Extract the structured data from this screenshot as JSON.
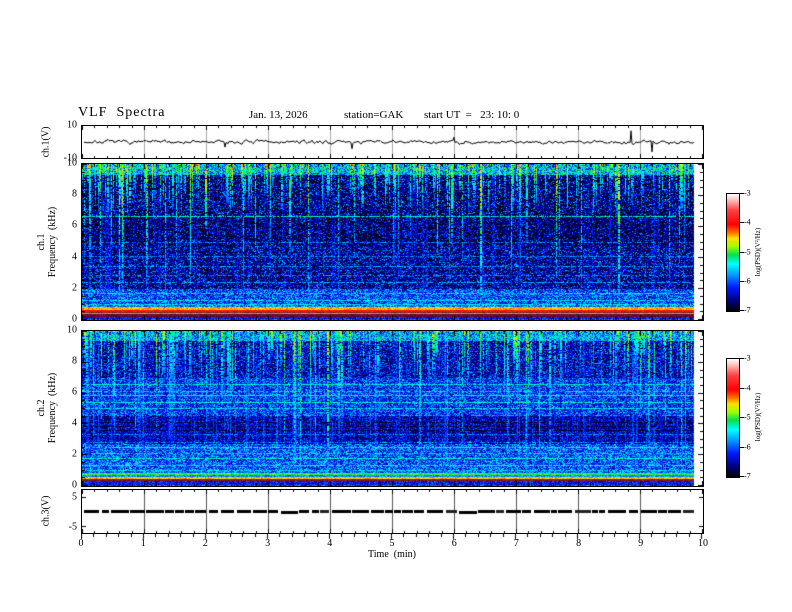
{
  "title": {
    "main": "VLF  Spectra",
    "date": "Jan. 13, 2026",
    "station": "station=GAK",
    "start": "start UT  =   23: 10: 0"
  },
  "axis": {
    "x_label": "Time  (min)",
    "x_ticks": [
      "0",
      "1",
      "2",
      "3",
      "4",
      "5",
      "6",
      "7",
      "8",
      "9",
      "10"
    ],
    "spec_y_ticks": [
      "10",
      "8",
      "6",
      "4",
      "2",
      "0"
    ],
    "wave_y_ticks": [
      "10",
      "-10"
    ],
    "ch3_y_ticks": [
      "5",
      "-5"
    ]
  },
  "labels": {
    "ch1_wave": "ch.1(V)",
    "spec1_line1": "ch.1",
    "spec1_line2": "Frequency  (kHz)",
    "spec2_line1": "ch.2",
    "spec2_line2": "Frequency  (kHz)",
    "ch3": "ch.3(V)"
  },
  "colorbar": {
    "label": "log(PSD)(V²/Hz)",
    "ticks": [
      "-3",
      "-4",
      "-5",
      "-6",
      "-7"
    ]
  },
  "chart_data": [
    {
      "panel": "ch1_waveform",
      "type": "line",
      "ylabel": "ch.1(V)",
      "ylim": [
        -10,
        10
      ],
      "xlim": [
        0,
        10
      ],
      "data_frac": 0.985,
      "baseline_v": 0,
      "noise_amp_v": 1.6,
      "spikes": [
        {
          "t": 2.3,
          "v": -3.2
        },
        {
          "t": 4.35,
          "v": -4.2
        },
        {
          "t": 6.0,
          "v": 3.0
        },
        {
          "t": 8.85,
          "v": 7.0
        },
        {
          "t": 9.2,
          "v": -6.2
        }
      ],
      "seed": 7
    },
    {
      "panel": "ch1_spectrogram",
      "type": "heatmap",
      "ylabel": "ch.1 Frequency (kHz)",
      "ylim": [
        0,
        10
      ],
      "xlim": [
        0,
        10
      ],
      "data_frac": 0.985,
      "colorbar": {
        "label": "log(PSD)(V²/Hz)",
        "ticks": [
          -3,
          -4,
          -5,
          -6,
          -7
        ],
        "zlim": [
          -7,
          -3
        ]
      },
      "seed": 11,
      "regions": [
        {
          "f": [
            9.35,
            10.01
          ],
          "base": 0.15,
          "amp": 0.38,
          "pow": 1
        },
        {
          "f": [
            6.6,
            9.35
          ],
          "base": 0.02,
          "amp": 0.34,
          "pow": 3
        },
        {
          "f": [
            4.8,
            6.6
          ],
          "base": 0.02,
          "amp": 0.3,
          "pow": 3
        },
        {
          "f": [
            2.0,
            4.8
          ],
          "base": 0.03,
          "amp": 0.32,
          "pow": 2.4
        },
        {
          "f": [
            1.0,
            2.0
          ],
          "base": 0.1,
          "amp": 0.3,
          "pow": 1.2
        },
        {
          "f": [
            0.85,
            1.0
          ],
          "base": 0.16,
          "amp": 0.26,
          "pow": 1
        },
        {
          "f": [
            0.0,
            0.85
          ],
          "base": 0.12,
          "amp": 0.2,
          "pow": 1
        }
      ],
      "hlines": [
        {
          "f": 6.65,
          "v": 0.42,
          "p": 0.8
        },
        {
          "f": 5.0,
          "v": 0.3,
          "p": 0.5
        },
        {
          "f": 4.1,
          "v": 0.3,
          "p": 0.5
        },
        {
          "f": 3.45,
          "v": 0.32,
          "p": 0.6
        },
        {
          "f": 2.9,
          "v": 0.3,
          "p": 0.5
        },
        {
          "f": 2.45,
          "v": 0.32,
          "p": 0.6
        },
        {
          "f": 1.75,
          "v": 0.36,
          "p": 0.7
        },
        {
          "f": 1.3,
          "v": 0.38,
          "p": 0.7
        },
        {
          "f": 1.05,
          "v": 0.4,
          "p": 0.8
        }
      ],
      "darklines": [],
      "bands": [
        {
          "f": [
            0.62,
            0.85
          ],
          "v": 0.64,
          "j": 0.05
        },
        {
          "f": [
            0.54,
            0.62
          ],
          "v": 0.74,
          "j": 0.03
        },
        {
          "f": [
            0.46,
            0.54
          ],
          "rgb": [
            150,
            20,
            30
          ],
          "j": 35
        },
        {
          "f": [
            0.38,
            0.46
          ],
          "v": 0.5,
          "j": 0.04
        },
        {
          "f": [
            0.22,
            0.38
          ],
          "rgb": [
            115,
            5,
            45
          ],
          "j": 30
        },
        {
          "f": [
            0.04,
            0.22
          ],
          "v": 0.18,
          "j": 0.1
        }
      ],
      "streaks": {
        "count": 250,
        "depth": [
          0.8,
          3.2
        ],
        "deepProb": 0.2,
        "deepDepth": [
          3.5,
          9.8
        ],
        "v": [
          0.42,
          0.68
        ]
      },
      "faint": {
        "count": 140,
        "v": [
          0.1,
          0.22
        ]
      },
      "dots": {
        "count": 10,
        "f": [
          7.0,
          9.6
        ],
        "v": [
          0.75,
          0.95
        ]
      }
    },
    {
      "panel": "ch2_spectrogram",
      "type": "heatmap",
      "ylabel": "ch.2 Frequency (kHz)",
      "ylim": [
        0,
        10
      ],
      "xlim": [
        0,
        10
      ],
      "data_frac": 0.985,
      "colorbar": {
        "label": "log(PSD)(V²/Hz)",
        "ticks": [
          -3,
          -4,
          -5,
          -6,
          -7
        ],
        "zlim": [
          -7,
          -3
        ]
      },
      "seed": 23,
      "regions": [
        {
          "f": [
            9.4,
            10.01
          ],
          "base": 0.15,
          "amp": 0.33,
          "pow": 1
        },
        {
          "f": [
            7.0,
            9.4
          ],
          "base": 0.05,
          "amp": 0.3,
          "pow": 2.2
        },
        {
          "f": [
            4.6,
            7.0
          ],
          "base": 0.1,
          "amp": 0.28,
          "pow": 1.4
        },
        {
          "f": [
            2.9,
            4.6
          ],
          "base": 0.05,
          "amp": 0.24,
          "pow": 2
        },
        {
          "f": [
            1.0,
            2.9
          ],
          "base": 0.11,
          "amp": 0.3,
          "pow": 1.2
        },
        {
          "f": [
            0.85,
            1.0
          ],
          "base": 0.14,
          "amp": 0.26,
          "pow": 1
        },
        {
          "f": [
            0.0,
            0.85
          ],
          "base": 0.12,
          "amp": 0.2,
          "pow": 1
        }
      ],
      "hlines": [
        {
          "f": 6.6,
          "v": 0.42,
          "p": 0.8
        },
        {
          "f": 6.15,
          "v": 0.38,
          "p": 0.6
        },
        {
          "f": 5.9,
          "v": 0.44,
          "p": 0.8
        },
        {
          "f": 5.45,
          "v": 0.42,
          "p": 0.8
        },
        {
          "f": 5.05,
          "v": 0.4,
          "p": 0.7
        },
        {
          "f": 4.55,
          "v": 0.34,
          "p": 0.5
        },
        {
          "f": 3.35,
          "v": 0.3,
          "p": 0.5
        },
        {
          "f": 2.5,
          "v": 0.4,
          "p": 0.7
        },
        {
          "f": 2.1,
          "v": 0.36,
          "p": 0.6
        },
        {
          "f": 1.8,
          "v": 0.42,
          "p": 0.8
        },
        {
          "f": 1.35,
          "v": 0.4,
          "p": 0.7
        },
        {
          "f": 1.05,
          "v": 0.38,
          "p": 0.7
        }
      ],
      "darklines": [
        {
          "f": 3.6
        },
        {
          "f": 3.9
        },
        {
          "f": 4.15
        },
        {
          "f": 2.75
        }
      ],
      "bands": [
        {
          "f": [
            0.7,
            0.82
          ],
          "v": 0.5,
          "j": 0.05
        },
        {
          "f": [
            0.58,
            0.7
          ],
          "v": 0.3,
          "j": 0.08
        },
        {
          "f": [
            0.46,
            0.58
          ],
          "v": 0.62,
          "j": 0.06
        },
        {
          "f": [
            0.34,
            0.46
          ],
          "rgb": [
            130,
            25,
            35
          ],
          "j": 30
        },
        {
          "f": [
            0.04,
            0.34
          ],
          "v": 0.18,
          "j": 0.1
        }
      ],
      "streaks": {
        "count": 210,
        "depth": [
          1.2,
          4.5
        ],
        "deepProb": 0.3,
        "deepDepth": [
          5.0,
          9.8
        ],
        "v": [
          0.4,
          0.62
        ]
      },
      "faint": {
        "count": 190,
        "v": [
          0.12,
          0.26
        ]
      },
      "dots": {
        "count": 6,
        "f": [
          7.0,
          9.5
        ],
        "v": [
          0.7,
          0.9
        ]
      }
    },
    {
      "panel": "ch3_line",
      "type": "line",
      "ylabel": "ch.3(V)",
      "ylim": [
        -7.5,
        7.5
      ],
      "yticks": [
        5,
        -5
      ],
      "xlim": [
        0,
        10
      ],
      "data_frac": 0.985,
      "value_v": 0,
      "style": "thick-dashed",
      "seed": 5
    }
  ]
}
